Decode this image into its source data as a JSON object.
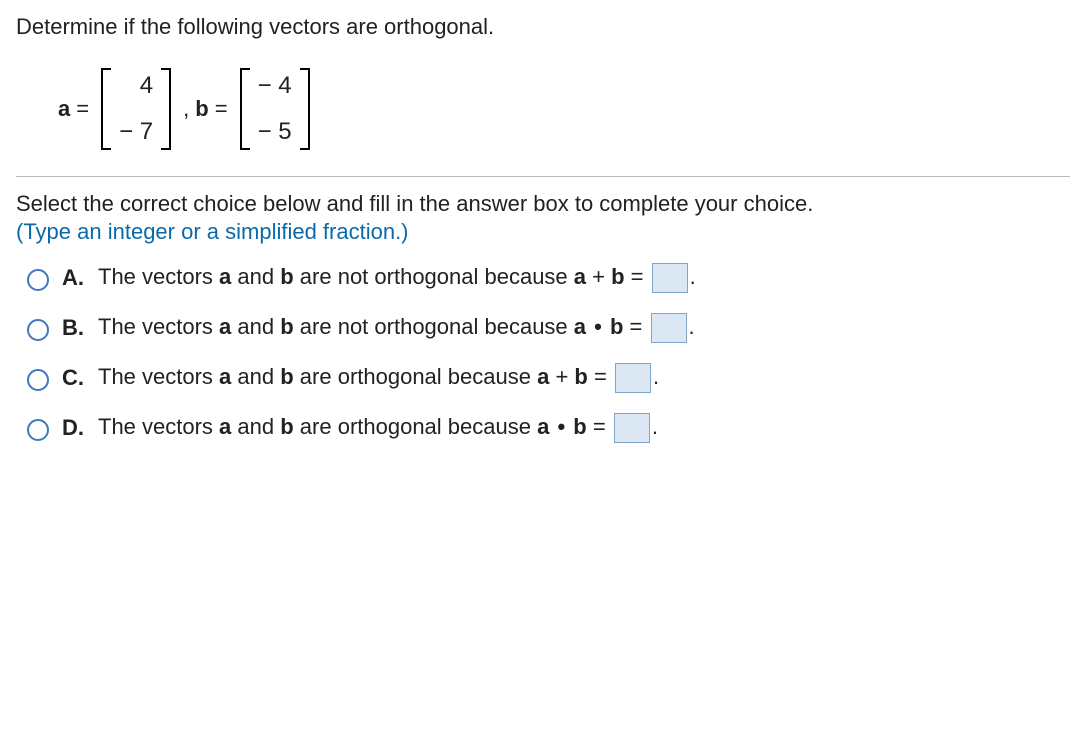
{
  "question": "Determine if the following vectors are orthogonal.",
  "vec_a_label": "a",
  "vec_b_label": "b",
  "eq": "=",
  "comma": ",",
  "a": [
    "4",
    "− 7"
  ],
  "b": [
    "− 4",
    "− 5"
  ],
  "instruction": "Select the correct choice below and fill in the answer box to complete your choice.",
  "hint": "(Type an integer or a simplified fraction.)",
  "choices": {
    "A": {
      "label": "A.",
      "pre": "The vectors ",
      "bold_a": "a",
      "mid1": " and ",
      "bold_b": "b",
      "mid2": " are not orthogonal because ",
      "bold_expr_a": "a",
      "op": " + ",
      "bold_expr_b": "b",
      "eq": " = ",
      "post": "."
    },
    "B": {
      "label": "B.",
      "pre": "The vectors ",
      "bold_a": "a",
      "mid1": " and ",
      "bold_b": "b",
      "mid2": " are not orthogonal because ",
      "bold_expr_a": "a",
      "op_dot": " • ",
      "bold_expr_b": "b",
      "eq": " = ",
      "post": "."
    },
    "C": {
      "label": "C.",
      "pre": "The vectors ",
      "bold_a": "a",
      "mid1": " and ",
      "bold_b": "b",
      "mid2": " are orthogonal because ",
      "bold_expr_a": "a",
      "op": " + ",
      "bold_expr_b": "b",
      "eq": " = ",
      "post": "."
    },
    "D": {
      "label": "D.",
      "pre": "The vectors ",
      "bold_a": "a",
      "mid1": " and ",
      "bold_b": "b",
      "mid2": " are orthogonal because ",
      "bold_expr_a": "a",
      "op_dot": " • ",
      "bold_expr_b": "b",
      "eq": " = ",
      "post": "."
    }
  }
}
